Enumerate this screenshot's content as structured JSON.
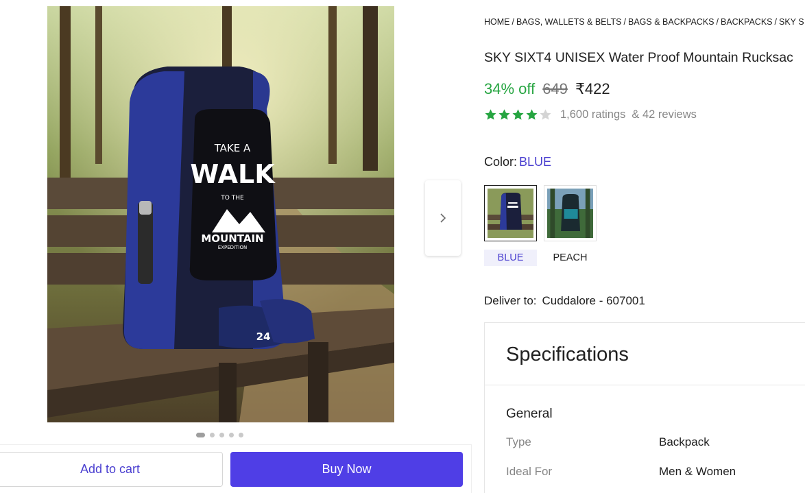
{
  "gallery": {
    "photo_text": {
      "line1": "TAKE A",
      "line2": "WALK",
      "line3": "TO THE",
      "line4": "MOUNTAIN",
      "line5": "EXPEDITION",
      "shoe_text": "24"
    },
    "dots_count": 5,
    "active_dot": 0
  },
  "actions": {
    "add_to_cart": "Add to cart",
    "buy_now": "Buy Now"
  },
  "breadcrumb": [
    "HOME",
    "BAGS, WALLETS & BELTS",
    "BAGS & BACKPACKS",
    "BACKPACKS",
    "SKY S"
  ],
  "breadcrumb_separator": "/",
  "product": {
    "title": "SKY SIXT4 UNISEX Water Proof Mountain Rucksac",
    "discount": "34% off",
    "mrp": "649",
    "price": "₹422",
    "rating": 4.0,
    "ratings_text": "1,600 ratings",
    "reviews_text": "& 42 reviews"
  },
  "color": {
    "label": "Color:",
    "selected": "BLUE",
    "options": [
      "BLUE",
      "PEACH"
    ]
  },
  "delivery": {
    "label": "Deliver to:",
    "location": "Cuddalore - 607001"
  },
  "specifications": {
    "title": "Specifications",
    "section": "General",
    "rows": [
      {
        "key": "Type",
        "value": "Backpack"
      },
      {
        "key": "Ideal For",
        "value": "Men & Women"
      }
    ]
  },
  "colors": {
    "accent": "#4f3ee6",
    "link": "#4a3fd0",
    "discount_green": "#26a541",
    "star_green": "#26a541"
  },
  "icons": {
    "next": "chevron-right-icon",
    "star": "star-icon"
  }
}
